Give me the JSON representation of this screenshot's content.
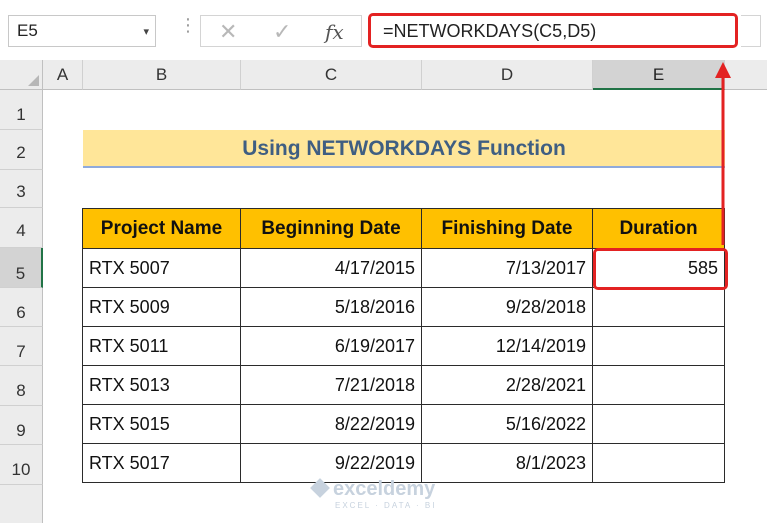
{
  "formula_bar": {
    "name_box": "E5",
    "name_box_dropdown": "▾",
    "separator": "⋮",
    "cancel_glyph": "✕",
    "enter_glyph": "✓",
    "fx_glyph": "fx",
    "formula": "=NETWORKDAYS(C5,D5)"
  },
  "columns": [
    "A",
    "B",
    "C",
    "D",
    "E"
  ],
  "rows": [
    "1",
    "2",
    "3",
    "4",
    "5",
    "6",
    "7",
    "8",
    "9",
    "10"
  ],
  "selected_cell": "E5",
  "sheet": {
    "title": "Using NETWORKDAYS Function",
    "headers": [
      "Project Name",
      "Beginning Date",
      "Finishing Date",
      "Duration"
    ],
    "rows": [
      {
        "name": "RTX 5007",
        "begin": "4/17/2015",
        "finish": "7/13/2017",
        "duration": "585"
      },
      {
        "name": "RTX 5009",
        "begin": "5/18/2016",
        "finish": "9/28/2018",
        "duration": ""
      },
      {
        "name": "RTX 5011",
        "begin": "6/19/2017",
        "finish": "12/14/2019",
        "duration": ""
      },
      {
        "name": "RTX 5013",
        "begin": "7/21/2018",
        "finish": "2/28/2021",
        "duration": ""
      },
      {
        "name": "RTX 5015",
        "begin": "8/22/2019",
        "finish": "5/16/2022",
        "duration": ""
      },
      {
        "name": "RTX 5017",
        "begin": "9/22/2019",
        "finish": "8/1/2023",
        "duration": ""
      }
    ]
  },
  "watermark": {
    "brand": "exceldemy",
    "tagline": "EXCEL · DATA · BI"
  },
  "colors": {
    "highlight": "#e32222",
    "header_fill": "#ffc000",
    "title_fill": "#ffe699",
    "title_text": "#3f5e82",
    "selection": "#217346"
  }
}
